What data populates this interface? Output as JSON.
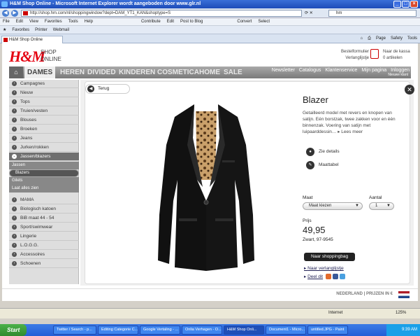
{
  "browser": {
    "window_title": "H&M Shop Online - Microsoft Internet Explorer wordt aangeboden door www.glr.nl",
    "url": "http://shop.hm.com/nl/shoppingwindow?dept=DAM_YT1_KAN&shoptype=S",
    "search_value": "hm",
    "menu": [
      "File",
      "Edit",
      "View",
      "Favorites",
      "Tools",
      "Help",
      "Contribute",
      "Edit",
      "Post to Blog",
      "Convert",
      "Select"
    ],
    "favorites": [
      "Favorites",
      "Printer",
      "Webmail"
    ],
    "tab_title": "H&M Shop Online",
    "tools": [
      "Page",
      "Safety",
      "Tools"
    ]
  },
  "header": {
    "logo": "H&M",
    "shop_line1": "SHOP",
    "shop_line2": "ONLINE",
    "bestel_line1": "Bestelformulier",
    "bestel_line2": "Verlanglijstje",
    "kassa_line1": "Naar de kassa",
    "kassa_line2": "0 artikelen"
  },
  "nav": {
    "items": [
      "DAMES",
      "HEREN",
      "DIVIDED",
      "KINDEREN",
      "COSMETICA",
      "HOME",
      "SALE"
    ],
    "sub": [
      "Newsletter",
      "Catalogus",
      "Klantenservice",
      "Mijn pagina",
      "Inloggen"
    ],
    "nieuwe": "Nieuwe klant"
  },
  "sidebar": {
    "items_top": [
      "Campagnes",
      "Nieuw",
      "Tops",
      "Truien/vesten",
      "Blouses",
      "Broeken",
      "Jeans",
      "Jurken/rokken"
    ],
    "open_item": "Jassen/blazers",
    "subitems": [
      "Jassen",
      "Blazers",
      "Gilets",
      "Laat alles zien"
    ],
    "items_bottom": [
      "MAMA",
      "Biologisch katoen",
      "BiB maat 44 - 54",
      "Sport/swimwear",
      "Lingerie",
      "L.O.G.G.",
      "Accessoires",
      "Schoenen"
    ]
  },
  "product": {
    "back": "Terug",
    "title": "Blazer",
    "description": "Getailleerd model met revers en knopen van satijn. Eén borstzak, twee zakken voor en één binnenzak. Voering van satijn met luipaarddessin…",
    "more": "▸ Lees meer",
    "zie_details": "Zie details",
    "maattabel": "Maattabel",
    "maat_label": "Maat",
    "maat_value": "Maat kiezen",
    "aantal_label": "Aantal",
    "aantal_value": "1",
    "prijs_label": "Prijs",
    "price": "49,95",
    "color_code": "Zwart, 97-9545",
    "bag_button": "Naar shoppingbag",
    "wishlist": "Naar verlanglijstje",
    "share": "Deel dit"
  },
  "footer": {
    "country": "NEDERLAND | PRIJZEN IN €"
  },
  "status": {
    "zone": "Internet",
    "zoom": "125%"
  },
  "taskbar": {
    "start": "Start",
    "buttons": [
      "Twitter / Search - p...",
      "Editing Categorie C...",
      "Google Vertaling - ...",
      "Onlia Verhagen - O...",
      "H&M Shop Onli...",
      "Document1 - Micro...",
      "untitled.JPG - Paint"
    ],
    "clock": "9:39 AM"
  },
  "colors": {
    "brand_red": "#e50010",
    "nav_gray": "#8a8a8a",
    "sidebar_bg": "#dedede"
  }
}
